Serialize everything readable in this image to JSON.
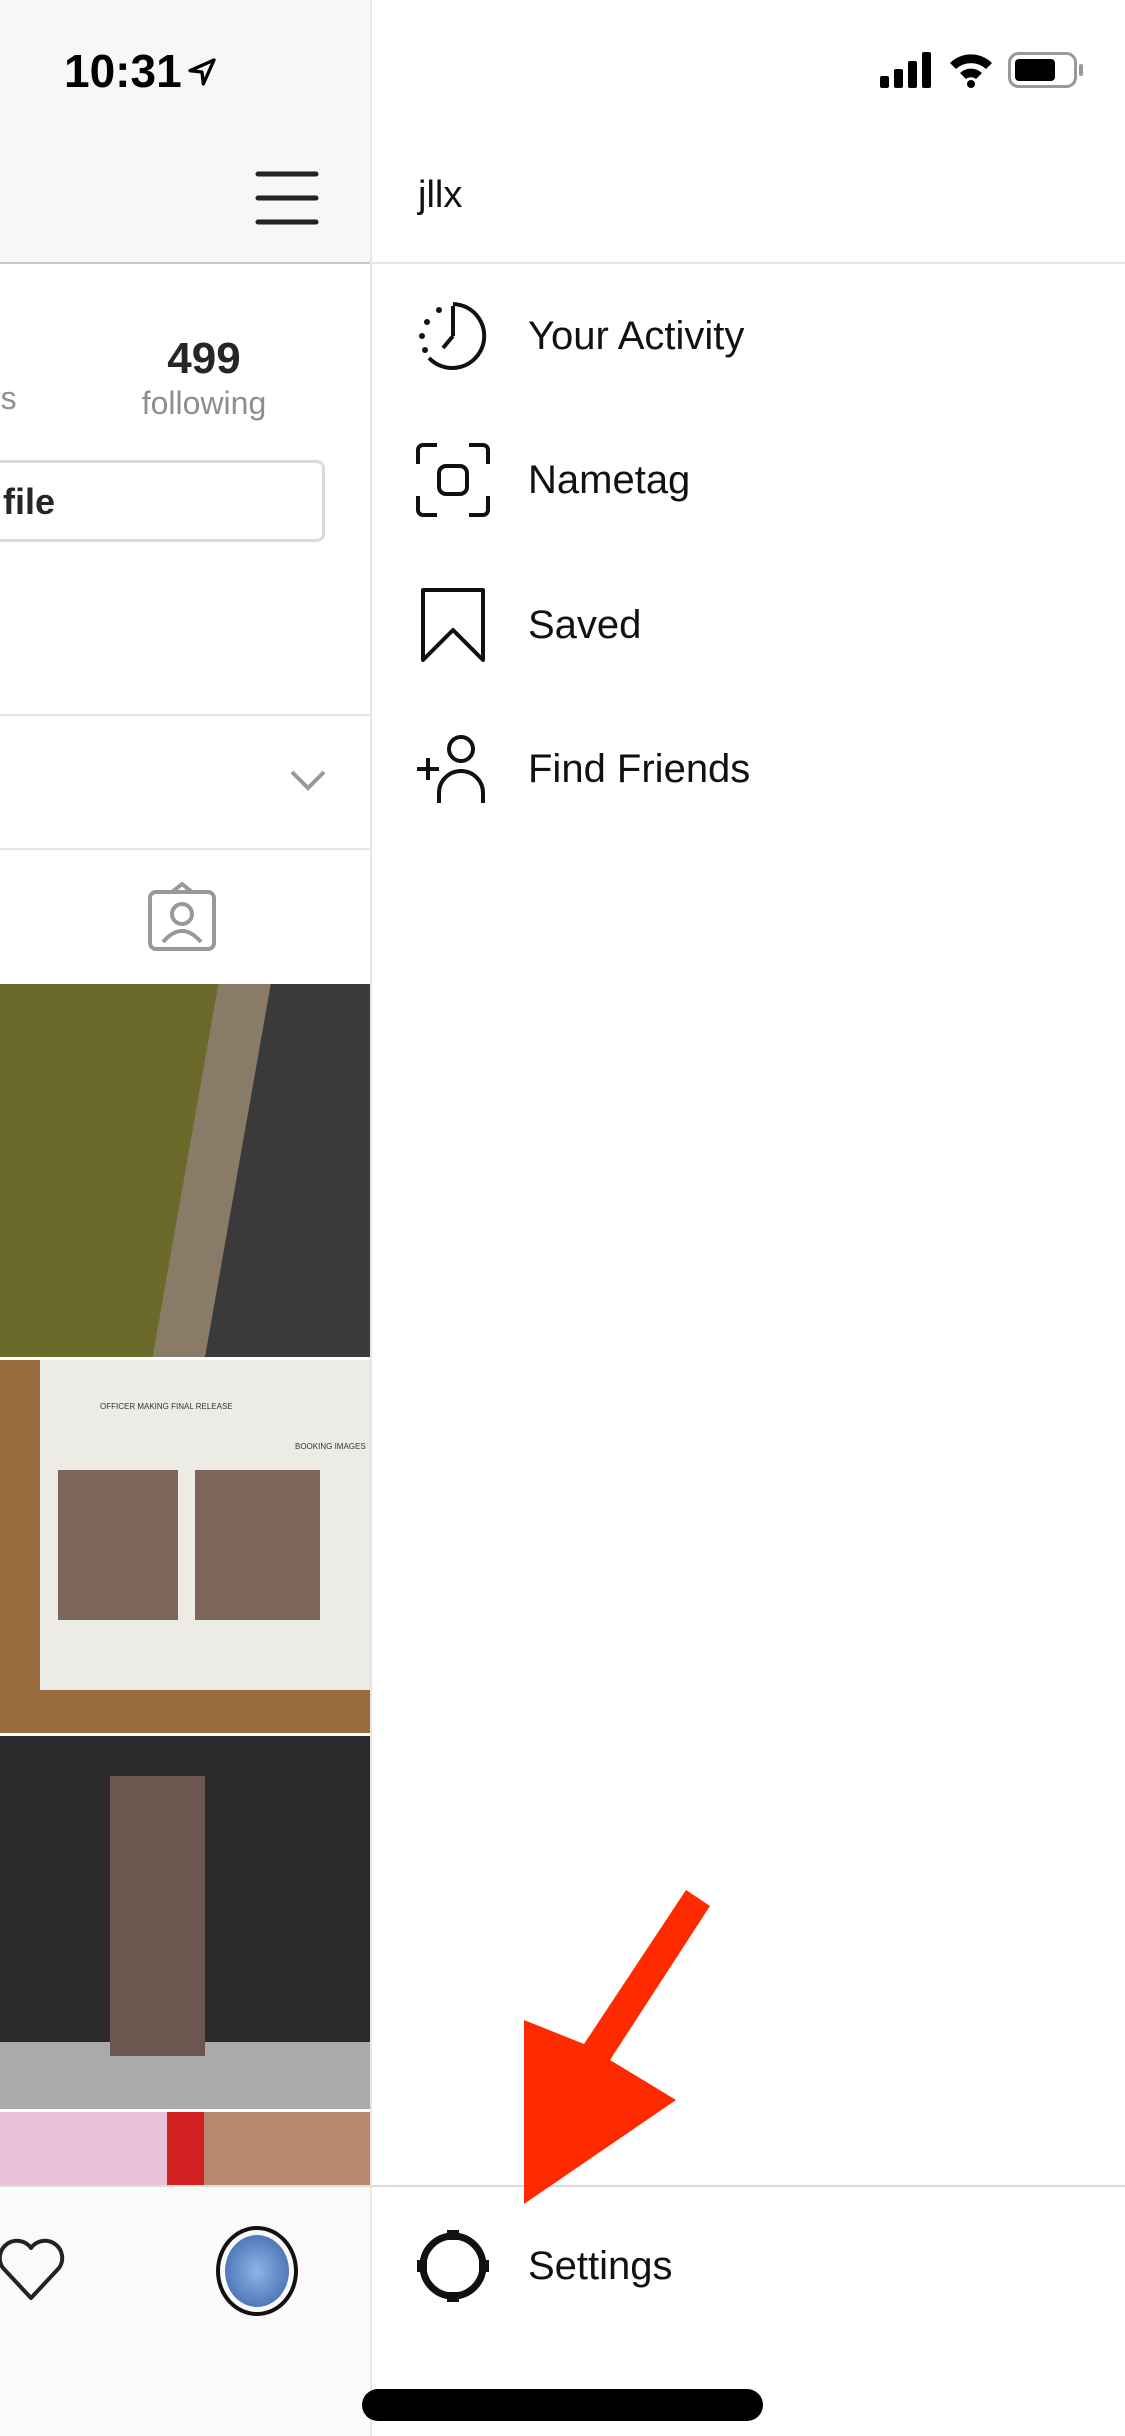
{
  "status_bar": {
    "time": "10:31",
    "location_icon": "location-arrow-icon",
    "signal_icon": "cellular-signal-icon",
    "wifi_icon": "wifi-icon",
    "battery_icon": "battery-icon"
  },
  "profile": {
    "followers_label_fragment": "rs",
    "following_count": "499",
    "following_label": "following",
    "edit_button_fragment": "file",
    "menu_icon": "hamburger-icon"
  },
  "drawer": {
    "username": "jllx",
    "items": [
      {
        "label": "Your Activity",
        "icon": "activity-clock-icon"
      },
      {
        "label": "Nametag",
        "icon": "nametag-icon"
      },
      {
        "label": "Saved",
        "icon": "bookmark-icon"
      },
      {
        "label": "Find Friends",
        "icon": "add-person-icon"
      }
    ],
    "settings_label": "Settings"
  },
  "annotation": {
    "arrow_color": "#ff2a00"
  },
  "photo_grid_text": {
    "form_header": "OFFICER MAKING FINAL RELEASE",
    "form_subheader": "BOOKING IMAGES"
  }
}
